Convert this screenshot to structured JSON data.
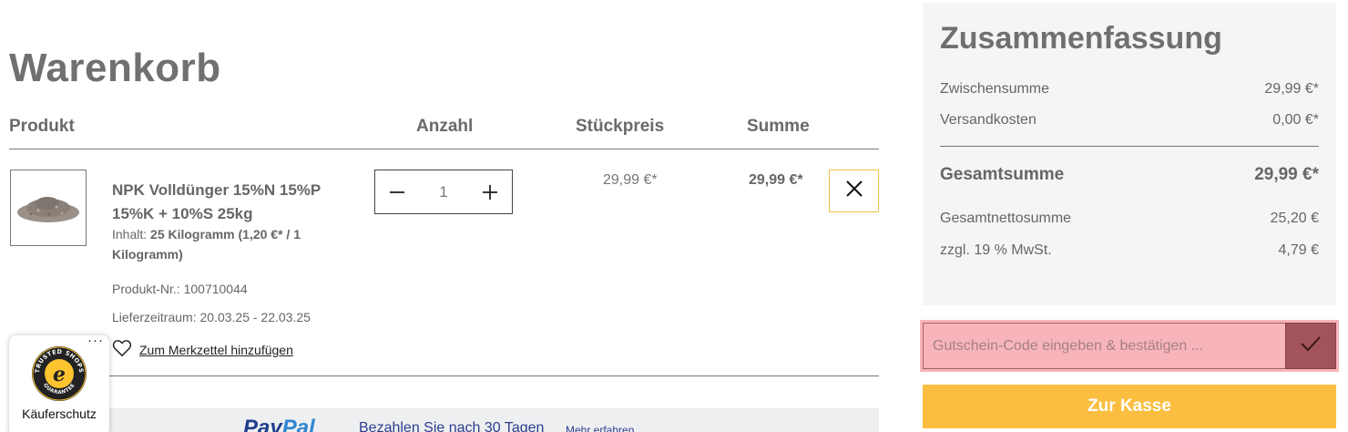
{
  "cart": {
    "title": "Warenkorb",
    "headers": {
      "product": "Produkt",
      "quantity": "Anzahl",
      "unit_price": "Stückpreis",
      "sum": "Summe"
    },
    "item": {
      "name": "NPK Volldünger 15%N 15%P 15%K + 10%S 25kg",
      "content_label": "Inhalt:",
      "content_value": "25 Kilogramm (1,20 €* / 1 Kilogramm)",
      "product_nr": "Produkt-Nr.: 100710044",
      "delivery": "Lieferzeitraum: 20.03.25 - 22.03.25",
      "wishlist_label": "Zum Merkzettel hinzufügen",
      "quantity": "1",
      "unit_price": "29,99 €*",
      "sum": "29,99 €*"
    },
    "paypal": {
      "logo_pay": "Pay",
      "logo_pal": "Pal",
      "text": "Bezahlen Sie nach 30 Tagen",
      "more": "Mehr erfahren"
    }
  },
  "trusted_shops": {
    "menu": "···",
    "label": "Käuferschutz",
    "seal_top": "TRUSTED SHOPS",
    "seal_bottom": "GUARANTEE"
  },
  "summary": {
    "title": "Zusammenfassung",
    "rows": [
      {
        "label": "Zwischensumme",
        "value": "29,99 €*"
      },
      {
        "label": "Versandkosten",
        "value": "0,00 €*"
      }
    ],
    "total": {
      "label": "Gesamtsumme",
      "value": "29,99 €*"
    },
    "net_rows": [
      {
        "label": "Gesamtnettosumme",
        "value": "25,20 €"
      },
      {
        "label": "zzgl. 19 % MwSt.",
        "value": "4,79 €"
      }
    ],
    "voucher_placeholder": "Gutschein-Code eingeben & bestätigen ...",
    "checkout_label": "Zur Kasse"
  },
  "colors": {
    "checkout": "#fbbe40",
    "remove_border": "#f0c24a",
    "voucher_highlight": "#f7b5bb",
    "paypal_blue": "#1f3e8c"
  }
}
